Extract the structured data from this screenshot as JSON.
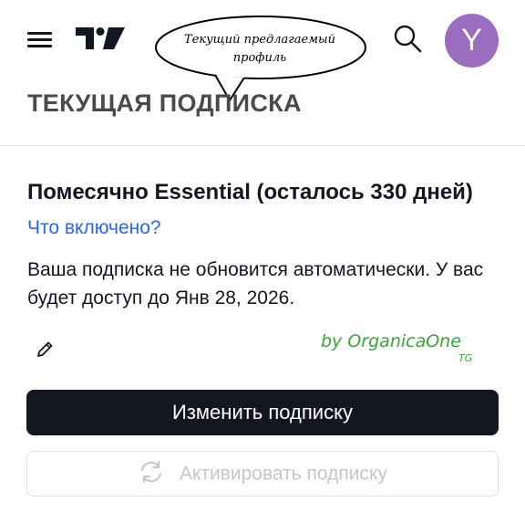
{
  "header": {
    "menu_icon": "hamburger-menu-icon",
    "logo_icon": "tradingview-logo",
    "annotation_bubble": "Текущий предлагаемый профиль",
    "search_icon": "search-icon",
    "avatar_letter": "Y",
    "avatar_color": "#9b6cc0"
  },
  "section": {
    "title": "ТЕКУЩАЯ ПОДПИСКА"
  },
  "subscription": {
    "plan_title": "Помесячно Essential (осталось 330 дней)",
    "whats_included_link": "Что включено?",
    "description": "Ваша подписка не обновится автоматически. У вас будет доступ до Янв 28, 2026.",
    "edit_icon": "pencil-icon"
  },
  "watermark": {
    "text": "by OrganicaOne",
    "sub": "TG",
    "color": "#3aa43a"
  },
  "actions": {
    "change_label": "Изменить подписку",
    "activate_label": "Активировать подписку",
    "activate_icon": "refresh-icon"
  },
  "colors": {
    "primary_button": "#131722",
    "link": "#2962ff",
    "disabled_text": "#c3c6cf"
  }
}
